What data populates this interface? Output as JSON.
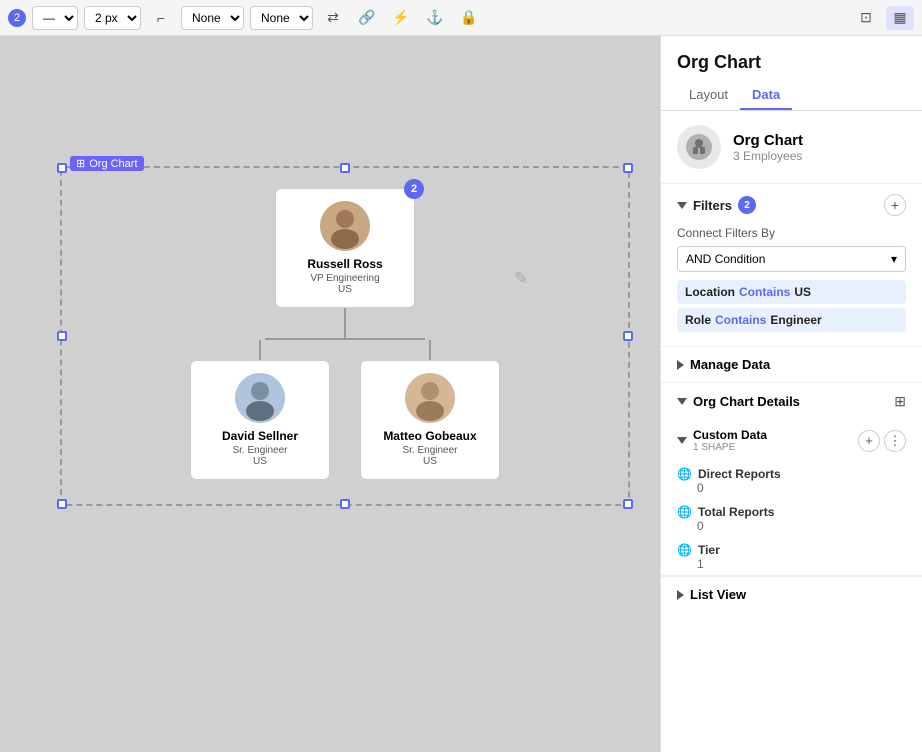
{
  "toolbar": {
    "badge": "2",
    "line_style": "—",
    "line_width": "2 px",
    "corner_none1": "None",
    "corner_none2": "None"
  },
  "panel": {
    "title": "Org Chart",
    "tabs": [
      "Layout",
      "Data"
    ],
    "active_tab": "Data",
    "chart_icon": "🏢",
    "chart_name": "Org Chart",
    "chart_employees": "3 Employees"
  },
  "filters": {
    "label": "Filters",
    "count": "2",
    "connect_by_label": "Connect Filters By",
    "dropdown_value": "AND Condition",
    "filter1": {
      "key": "Location",
      "op": "Contains",
      "val": "US"
    },
    "filter2": {
      "key": "Role",
      "op": "Contains",
      "val": "Engineer"
    }
  },
  "manage_data": {
    "label": "Manage Data"
  },
  "org_chart_details": {
    "label": "Org Chart Details",
    "custom_data": {
      "title": "Custom Data",
      "subtitle": "1 SHAPE"
    },
    "direct_reports": {
      "label": "Direct Reports",
      "value": "0"
    },
    "total_reports": {
      "label": "Total Reports",
      "value": "0"
    },
    "tier": {
      "label": "Tier",
      "value": "1"
    }
  },
  "list_view": {
    "label": "List View"
  },
  "employees": {
    "top": {
      "name": "Russell Ross",
      "title": "VP Engineering",
      "location": "US",
      "badge": "2"
    },
    "bottom_left": {
      "name": "David Sellner",
      "title": "Sr. Engineer",
      "location": "US"
    },
    "bottom_right": {
      "name": "Matteo Gobeaux",
      "title": "Sr. Engineer",
      "location": "US"
    }
  },
  "frame_label": "Org Chart"
}
